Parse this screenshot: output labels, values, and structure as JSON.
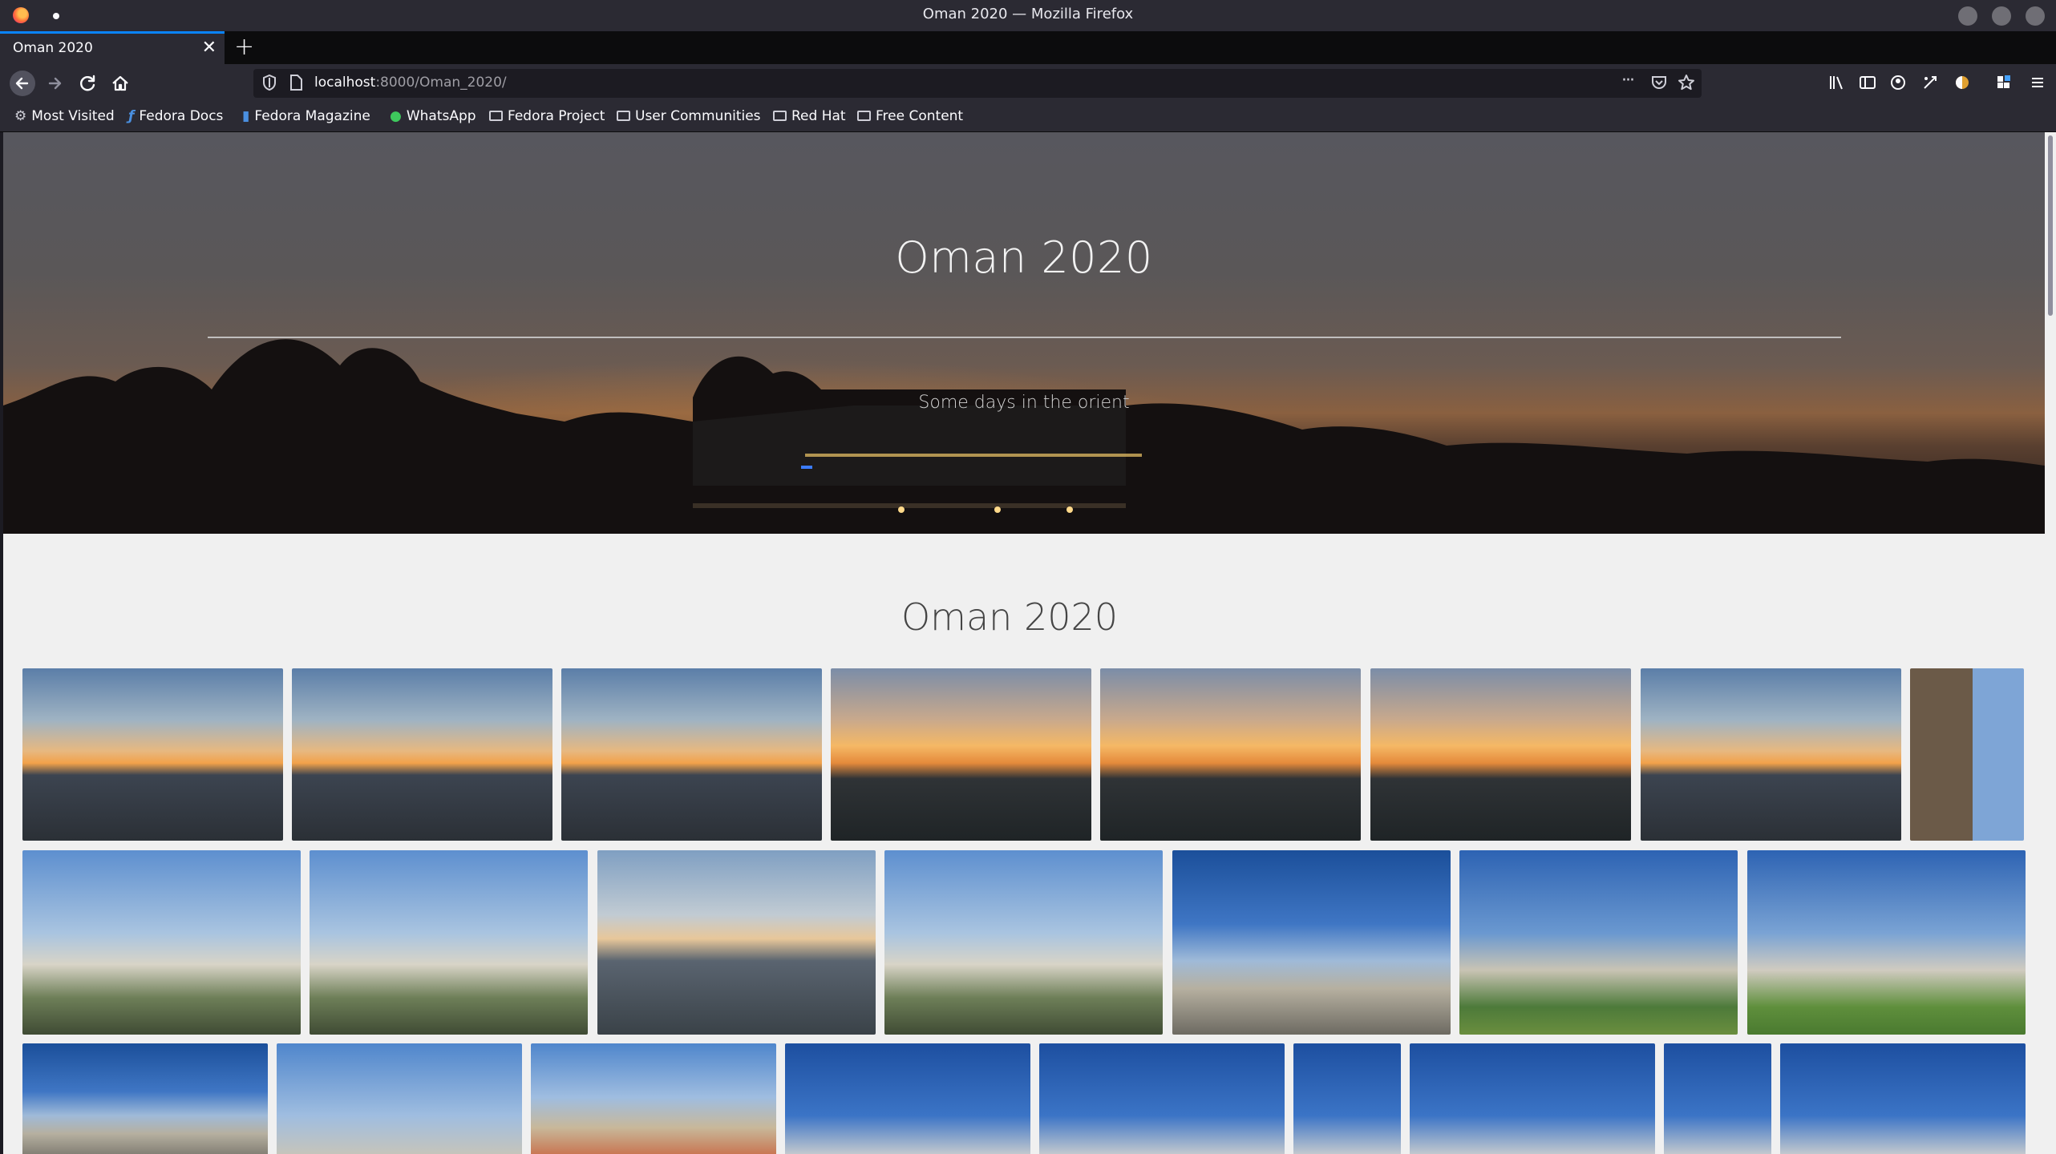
{
  "window": {
    "title": "Oman 2020 — Mozilla Firefox"
  },
  "tab": {
    "label": "Oman 2020",
    "close": "✕",
    "new_tab": "+"
  },
  "navbar": {
    "url_host": "localhost",
    "url_rest": ":8000/Oman_2020/",
    "page_actions": "···"
  },
  "bookmarks": [
    {
      "label": "Most Visited",
      "icon": "gear-icon"
    },
    {
      "label": "Fedora Docs",
      "icon": "fedora-icon"
    },
    {
      "label": "Fedora Magazine",
      "icon": "magazine-icon"
    },
    {
      "label": "WhatsApp",
      "icon": "whatsapp-icon"
    },
    {
      "label": "Fedora Project",
      "icon": "folder-icon"
    },
    {
      "label": "User Communities",
      "icon": "folder-icon"
    },
    {
      "label": "Red Hat",
      "icon": "folder-icon"
    },
    {
      "label": "Free Content",
      "icon": "folder-icon"
    }
  ],
  "hero": {
    "title": "Oman 2020",
    "subtitle": "Some days in the orient"
  },
  "gallery": {
    "title": "Oman 2020"
  },
  "colors": {
    "accent": "#0a84ff",
    "page_bg": "#f0f0f0",
    "chrome_bg": "#2b2a33"
  }
}
